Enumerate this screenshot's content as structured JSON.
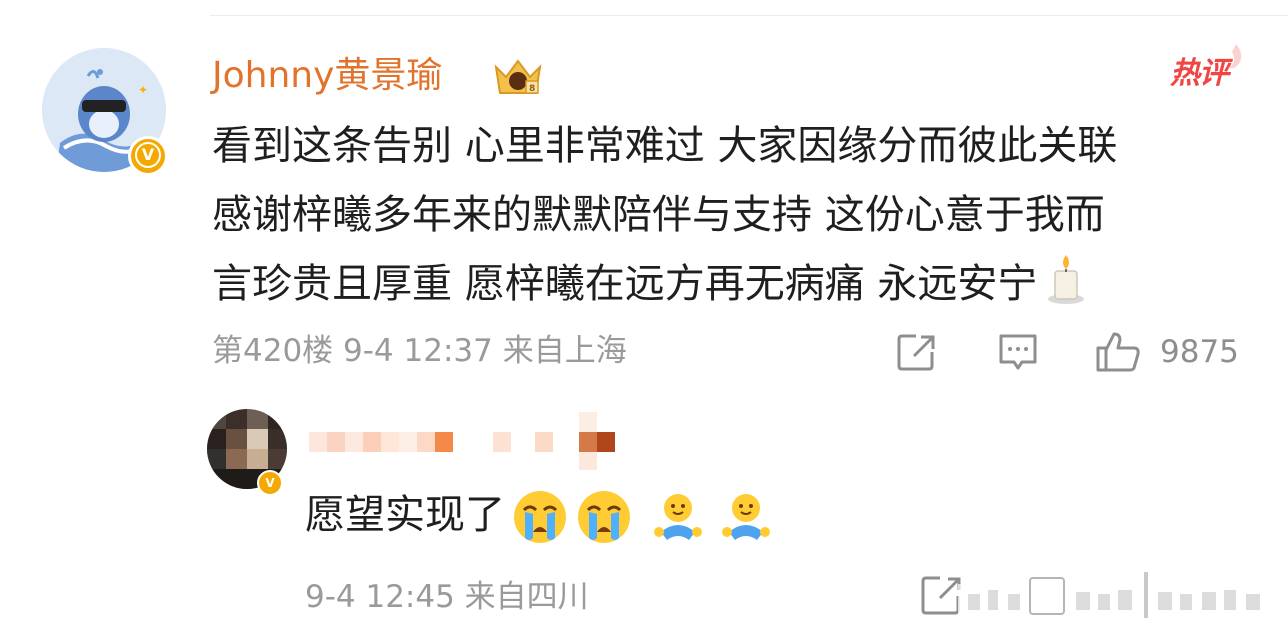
{
  "comment": {
    "username": "Johnny黄景瑜",
    "hot_badge": "热评",
    "lines": [
      "看到这条告别 心里非常难过 大家因缘分而彼此关联",
      "感谢梓曦多年来的默默陪伴与支持 这份心意于我而",
      "言珍贵且厚重 愿梓曦在远方再无病痛 永远安宁"
    ],
    "meta": "第420楼 9-4 12:37 来自上海",
    "like_count": "9875",
    "icons": [
      "share-icon",
      "comment-icon",
      "like-icon",
      "candle-emoji"
    ]
  },
  "reply": {
    "text": "愿望实现了",
    "meta": "9-4 12:45 来自四川",
    "emojis": [
      "crying-emoji",
      "crying-emoji",
      "hug-emoji",
      "hug-emoji"
    ]
  },
  "colors": {
    "username": "#e2732d",
    "hot": "#f04545",
    "meta": "#9a9a9a",
    "text": "#1f1f1f",
    "vip": "#f5a800"
  }
}
